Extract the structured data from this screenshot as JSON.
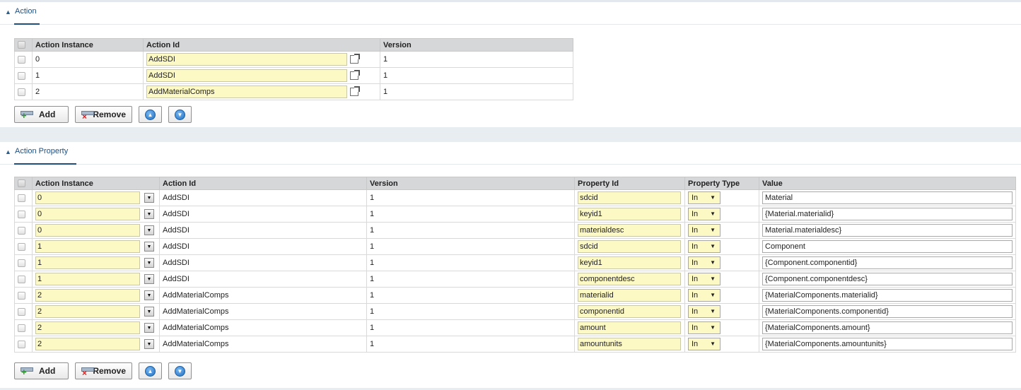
{
  "action_panel": {
    "title": "Action",
    "columns": [
      "",
      "Action Instance",
      "Action Id",
      "Version"
    ],
    "rows": [
      {
        "instance": "0",
        "action_id": "AddSDI",
        "version": "1"
      },
      {
        "instance": "1",
        "action_id": "AddSDI",
        "version": "1"
      },
      {
        "instance": "2",
        "action_id": "AddMaterialComps",
        "version": "1"
      }
    ],
    "buttons": {
      "add": "Add",
      "remove": "Remove"
    }
  },
  "property_panel": {
    "title": "Action Property",
    "columns": [
      "",
      "Action Instance",
      "Action Id",
      "Version",
      "Property Id",
      "Property Type",
      "Value"
    ],
    "rows": [
      {
        "instance": "0",
        "action_id": "AddSDI",
        "version": "1",
        "property_id": "sdcid",
        "property_type": "In",
        "value": "Material"
      },
      {
        "instance": "0",
        "action_id": "AddSDI",
        "version": "1",
        "property_id": "keyid1",
        "property_type": "In",
        "value": "{Material.materialid}"
      },
      {
        "instance": "0",
        "action_id": "AddSDI",
        "version": "1",
        "property_id": "materialdesc",
        "property_type": "In",
        "value": "Material.materialdesc}"
      },
      {
        "instance": "1",
        "action_id": "AddSDI",
        "version": "1",
        "property_id": "sdcid",
        "property_type": "In",
        "value": "Component"
      },
      {
        "instance": "1",
        "action_id": "AddSDI",
        "version": "1",
        "property_id": "keyid1",
        "property_type": "In",
        "value": "{Component.componentid}"
      },
      {
        "instance": "1",
        "action_id": "AddSDI",
        "version": "1",
        "property_id": "componentdesc",
        "property_type": "In",
        "value": "{Component.componentdesc}"
      },
      {
        "instance": "2",
        "action_id": "AddMaterialComps",
        "version": "1",
        "property_id": "materialid",
        "property_type": "In",
        "value": "{MaterialComponents.materialid}"
      },
      {
        "instance": "2",
        "action_id": "AddMaterialComps",
        "version": "1",
        "property_id": "componentid",
        "property_type": "In",
        "value": "{MaterialComponents.componentid}"
      },
      {
        "instance": "2",
        "action_id": "AddMaterialComps",
        "version": "1",
        "property_id": "amount",
        "property_type": "In",
        "value": "{MaterialComponents.amount}"
      },
      {
        "instance": "2",
        "action_id": "AddMaterialComps",
        "version": "1",
        "property_id": "amountunits",
        "property_type": "In",
        "value": "{MaterialComponents.amountunits}"
      }
    ],
    "buttons": {
      "add": "Add",
      "remove": "Remove"
    }
  },
  "icons": {
    "collapse": "chevron-up-icon",
    "open_external": "external-link-icon",
    "add": "add-row-icon",
    "remove": "remove-row-icon",
    "move_up": "arrow-up-circle-icon",
    "move_down": "arrow-down-circle-icon",
    "dropdown": "dropdown-arrow-icon"
  },
  "colors": {
    "title": "#1f4f7f",
    "header_bg": "#d6d7d9",
    "input_yellow": "#fdf9c4",
    "page_bg": "#e8edf2"
  }
}
